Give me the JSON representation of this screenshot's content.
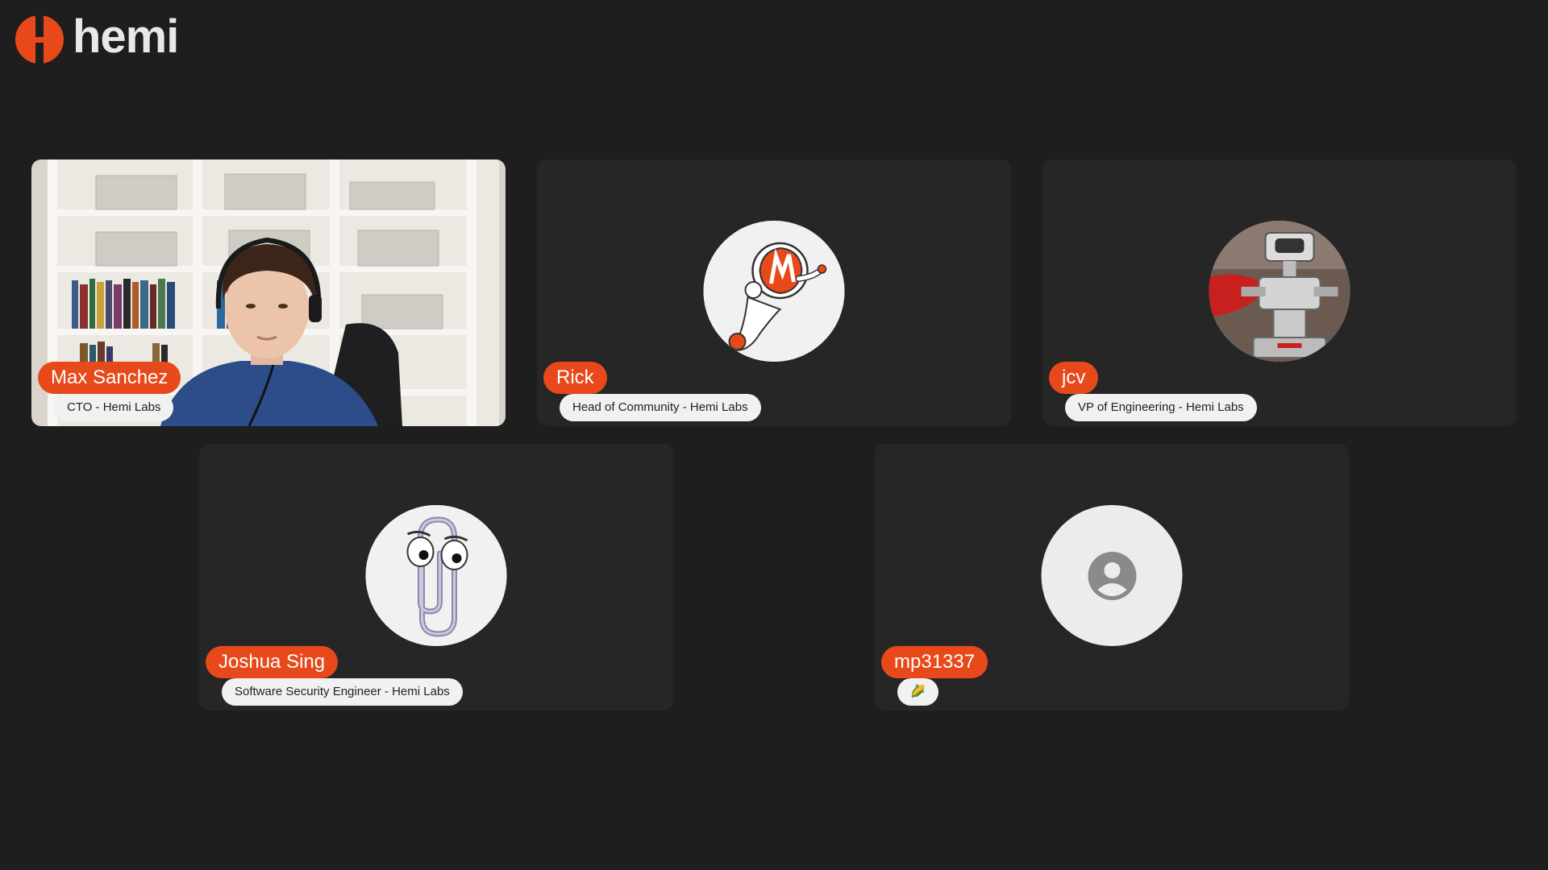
{
  "app": {
    "logo_text": "hemi",
    "accent_color": "#e8491a"
  },
  "participants": [
    {
      "name": "Max Sanchez",
      "title": "CTO - Hemi Labs",
      "avatar": "video-feed"
    },
    {
      "name": "Rick",
      "title": "Head of Community - Hemi Labs",
      "avatar": "astronaut-mascot-icon"
    },
    {
      "name": "jcv",
      "title": "VP of Engineering - Hemi Labs",
      "avatar": "robot-photo"
    },
    {
      "name": "Joshua Sing",
      "title": "Software Security Engineer - Hemi Labs",
      "avatar": "paperclip-mascot-icon"
    },
    {
      "name": "mp31337",
      "title": "🌽",
      "avatar": "default-user-icon"
    }
  ]
}
